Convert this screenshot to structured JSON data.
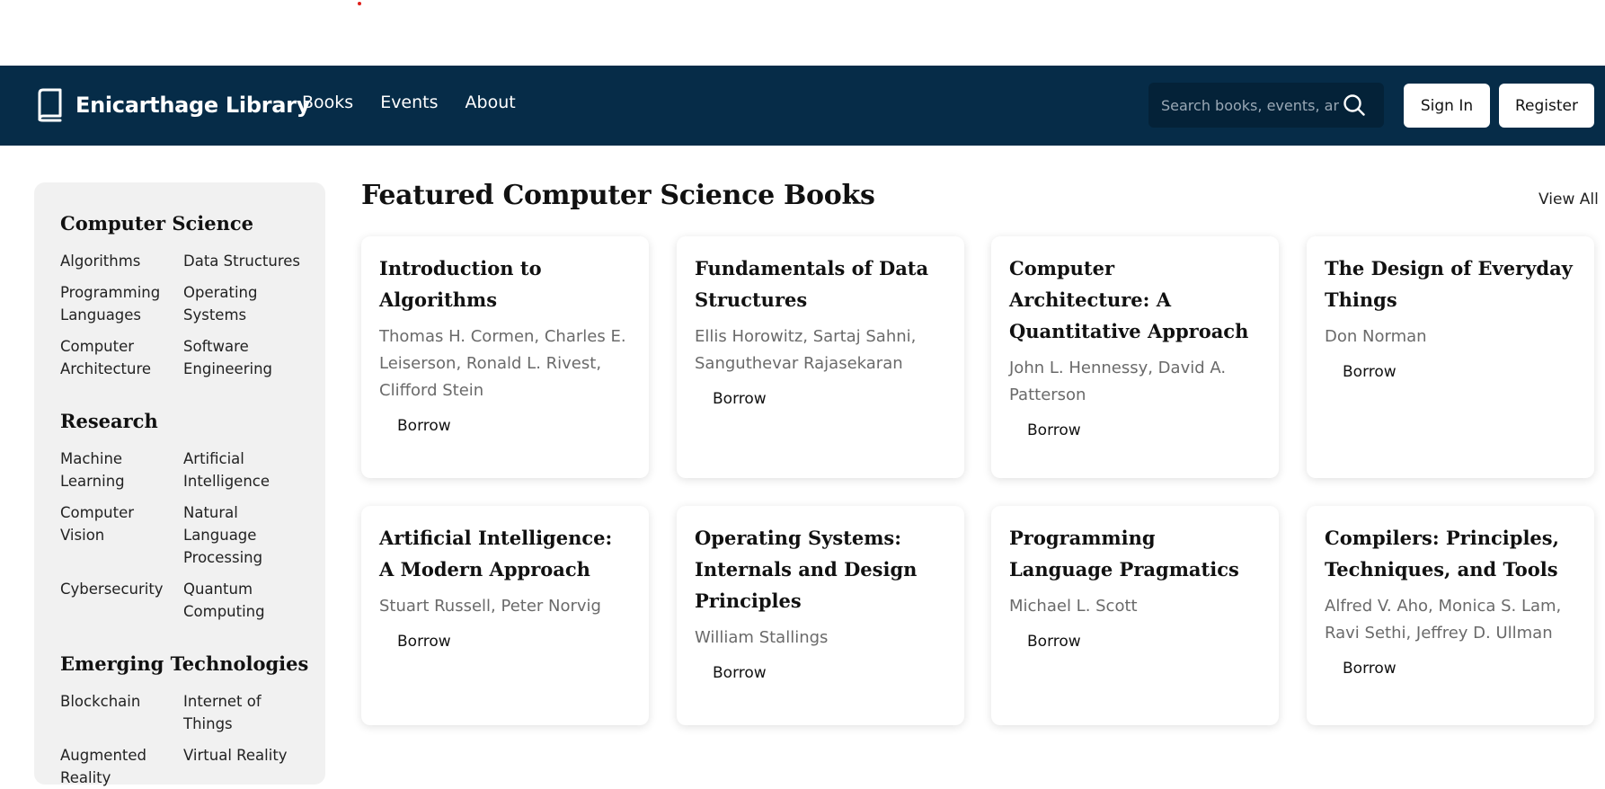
{
  "brand": {
    "name": "Enicarthage Library",
    "icon": "book-icon"
  },
  "nav": [
    {
      "label": "Books"
    },
    {
      "label": "Events"
    },
    {
      "label": "About"
    }
  ],
  "search": {
    "placeholder": "Search books, events, and more",
    "icon": "search-icon"
  },
  "auth": {
    "sign_in": "Sign In",
    "register": "Register"
  },
  "sidebar": {
    "sections": [
      {
        "title": "Computer Science",
        "links": [
          "Algorithms",
          "Data Structures",
          "Programming Languages",
          "Operating Systems",
          "Computer Architecture",
          "Software Engineering"
        ]
      },
      {
        "title": "Research",
        "links": [
          "Machine Learning",
          "Artificial Intelligence",
          "Computer Vision",
          "Natural Language Processing",
          "Cybersecurity",
          "Quantum Computing"
        ]
      },
      {
        "title": "Emerging Technologies",
        "links": [
          "Blockchain",
          "Internet of Things",
          "Augmented Reality",
          "Virtual Reality"
        ]
      }
    ]
  },
  "main": {
    "title": "Featured Computer Science Books",
    "view_all": "View All",
    "borrow_label": "Borrow",
    "books": [
      {
        "title": "Introduction to Algorithms",
        "authors": "Thomas H. Cormen, Charles E. Leiserson, Ronald L. Rivest, Clifford Stein"
      },
      {
        "title": "Fundamentals of Data Structures",
        "authors": "Ellis Horowitz, Sartaj Sahni, Sanguthevar Rajasekaran"
      },
      {
        "title": "Computer Architecture: A Quantitative Approach",
        "authors": "John L. Hennessy, David A. Patterson"
      },
      {
        "title": "The Design of Everyday Things",
        "authors": "Don Norman"
      },
      {
        "title": "Artificial Intelligence: A Modern Approach",
        "authors": "Stuart Russell, Peter Norvig"
      },
      {
        "title": "Operating Systems: Internals and Design Principles",
        "authors": "William Stallings"
      },
      {
        "title": "Programming Language Pragmatics",
        "authors": "Michael L. Scott"
      },
      {
        "title": "Compilers: Principles, Techniques, and Tools",
        "authors": "Alfred V. Aho, Monica S. Lam, Ravi Sethi, Jeffrey D. Ullman"
      }
    ]
  }
}
